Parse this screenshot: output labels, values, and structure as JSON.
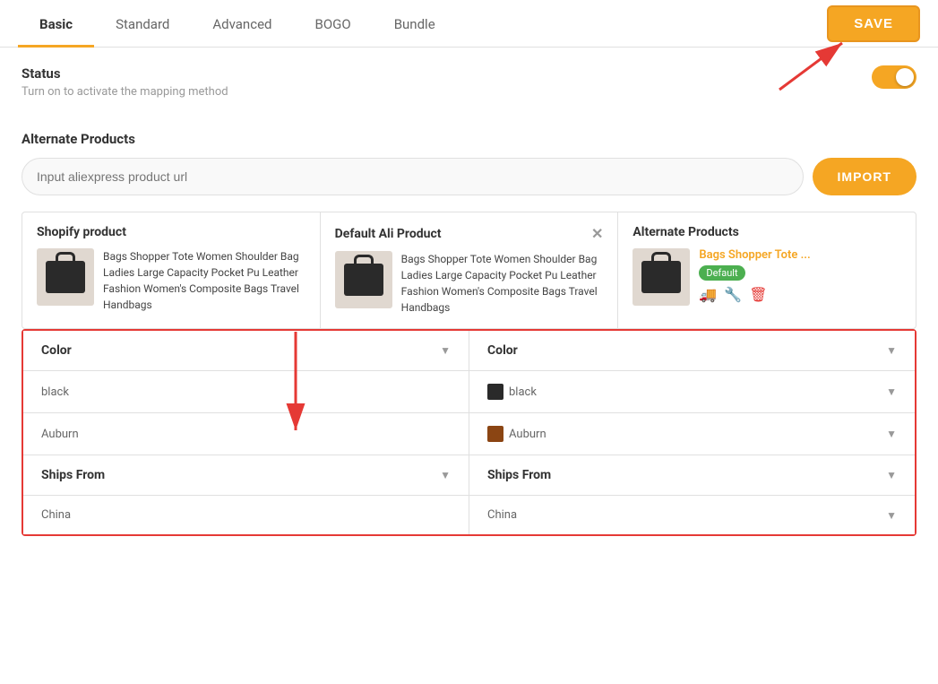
{
  "tabs": [
    {
      "id": "basic",
      "label": "Basic",
      "active": true
    },
    {
      "id": "standard",
      "label": "Standard",
      "active": false
    },
    {
      "id": "advanced",
      "label": "Advanced",
      "active": false
    },
    {
      "id": "bogo",
      "label": "BOGO",
      "active": false
    },
    {
      "id": "bundle",
      "label": "Bundle",
      "active": false
    }
  ],
  "save_button": "SAVE",
  "status": {
    "title": "Status",
    "subtitle": "Turn on to activate the mapping method",
    "toggle_on": true
  },
  "alternate_products": {
    "title": "Alternate Products",
    "input_placeholder": "Input aliexpress product url",
    "import_button": "IMPORT"
  },
  "columns": {
    "shopify": {
      "header": "Shopify product",
      "product_text": "Bags Shopper Tote Women Shoulder Bag Ladies Large Capacity Pocket Pu Leather Fashion Women&#39;s Composite Bags Travel Handbags"
    },
    "ali": {
      "header": "Default Ali Product",
      "product_text": "Bags Shopper Tote Women Shoulder Bag Ladies Large Capacity Pocket Pu Leather Fashion Women&#39;s Composite Bags Travel Handbags"
    },
    "alternate": {
      "header": "Alternate Products",
      "product_name": "Bags Shopper Tote ...",
      "badge": "Default",
      "actions": [
        "truck",
        "wrench",
        "trash"
      ]
    }
  },
  "variants": {
    "rows": [
      {
        "shopify_label": "Color",
        "ali_label": "Color",
        "is_header": true
      },
      {
        "shopify_value": "black",
        "ali_value": "black",
        "has_thumb": true,
        "is_header": false
      },
      {
        "shopify_value": "Auburn",
        "ali_value": "Auburn",
        "has_thumb": true,
        "is_header": false
      },
      {
        "shopify_label": "Ships From",
        "ali_label": "Ships From",
        "is_header": true
      },
      {
        "shopify_value": "China",
        "ali_value": "China",
        "has_thumb": false,
        "is_header": false
      }
    ]
  }
}
